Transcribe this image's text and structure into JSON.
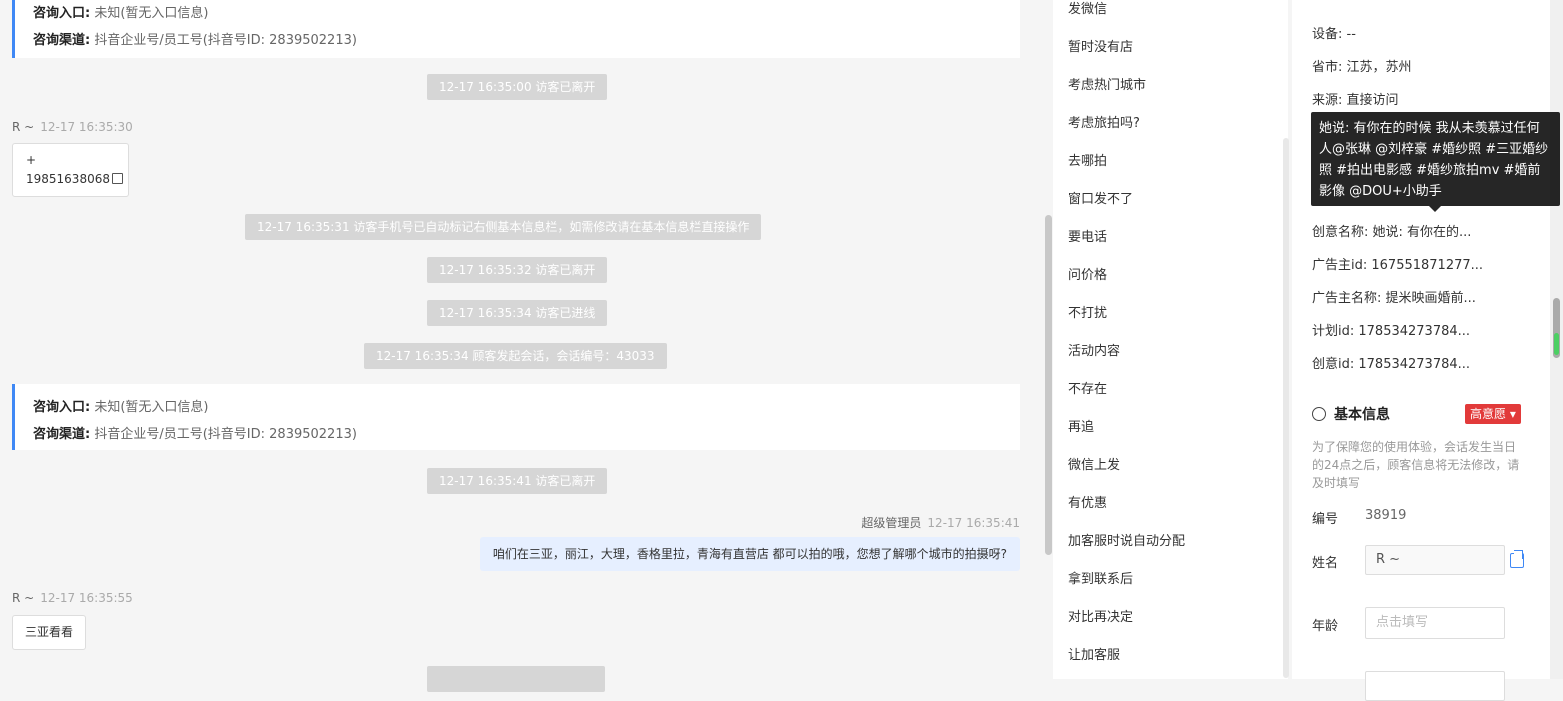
{
  "chat": {
    "card1": {
      "entry_label": "咨询入口:",
      "entry_value": "未知(暂无入口信息)",
      "channel_label": "咨询渠道:",
      "channel_value": "抖音企业号/员工号(抖音号ID: 2839502213)"
    },
    "sys1": "12-17 16:35:00 访客已离开",
    "msg1": {
      "sender": "R ~",
      "time": "12-17 16:35:30",
      "line1": "+",
      "line2": "19851638068"
    },
    "sys2": "12-17 16:35:31 访客手机号已自动标记右侧基本信息栏，如需修改请在基本信息栏直接操作",
    "sys3": "12-17 16:35:32 访客已离开",
    "sys4": "12-17 16:35:34 访客已进线",
    "sys5": "12-17 16:35:34 顾客发起会话，会话编号：43033",
    "card2": {
      "entry_label": "咨询入口:",
      "entry_value": "未知(暂无入口信息)",
      "channel_label": "咨询渠道:",
      "channel_value": "抖音企业号/员工号(抖音号ID: 2839502213)"
    },
    "sys6": "12-17 16:35:41 访客已离开",
    "msg2": {
      "sender": "超级管理员",
      "time": "12-17 16:35:41",
      "text": "咱们在三亚，丽江，大理，香格里拉，青海有直营店 都可以拍的哦，您想了解哪个城市的拍摄呀?"
    },
    "msg3": {
      "sender": "R ~",
      "time": "12-17 16:35:55",
      "text": "三亚看看"
    }
  },
  "quick_replies": [
    "发微信",
    "暂时没有店",
    "考虑热门城市",
    "考虑旅拍吗?",
    "去哪拍",
    "窗口发不了",
    "要电话",
    "问价格",
    "不打扰",
    "活动内容",
    "不存在",
    "再追",
    "微信上发",
    "有优惠",
    "加客服时说自动分配",
    "拿到联系后",
    "对比再决定",
    "让加客服"
  ],
  "panel": {
    "device": "设备: --",
    "province": "省市: 江苏，苏州",
    "source": "来源: 直接访问",
    "creative_name": "创意名称: 她说: 有你在的...",
    "advertiser_id": "广告主id: 167551871277...",
    "advertiser_name": "广告主名称: 提米映画婚前...",
    "plan_id": "计划id: 178534273784...",
    "creative_id": "创意id: 178534273784...",
    "basic_title": "基本信息",
    "intent_badge": "高意愿 ▾",
    "note": "为了保障您的使用体验，会话发生当日的24点之后，顾客信息将无法修改，请及时填写",
    "id_label": "编号",
    "id_value": "38919",
    "name_label": "姓名",
    "name_value": "R ~",
    "age_label": "年龄",
    "age_placeholder": "点击填写"
  },
  "tooltip": "她说: 有你在的时候 我从未羡慕过任何人@张琳 @刘梓豪 #婚纱照 #三亚婚纱照 #拍出电影感 #婚纱旅拍mv #婚前影像 @DOU+小助手",
  "colors": {
    "accent": "#3f88f5",
    "badge": "#e23a3a",
    "system_bubble": "#d6d6d6",
    "agent_bubble": "#e6efff"
  }
}
